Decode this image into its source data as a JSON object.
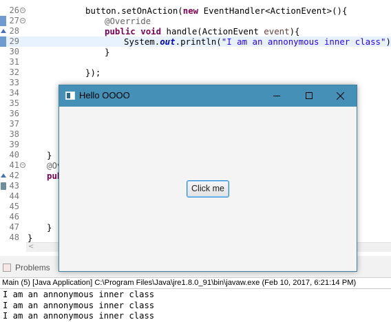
{
  "editor": {
    "lines": [
      {
        "num": "26",
        "fold": "⊖"
      },
      {
        "num": "27",
        "fold": "⊖"
      },
      {
        "num": "28",
        "fold": ""
      },
      {
        "num": "29",
        "fold": ""
      },
      {
        "num": "30",
        "fold": ""
      },
      {
        "num": "31",
        "fold": ""
      },
      {
        "num": "32",
        "fold": ""
      },
      {
        "num": "33",
        "fold": ""
      },
      {
        "num": "34",
        "fold": ""
      },
      {
        "num": "35",
        "fold": ""
      },
      {
        "num": "36",
        "fold": ""
      },
      {
        "num": "37",
        "fold": ""
      },
      {
        "num": "38",
        "fold": ""
      },
      {
        "num": "39",
        "fold": ""
      },
      {
        "num": "40",
        "fold": ""
      },
      {
        "num": "41",
        "fold": "⊖"
      },
      {
        "num": "42",
        "fold": ""
      },
      {
        "num": "43",
        "fold": ""
      },
      {
        "num": "44",
        "fold": ""
      },
      {
        "num": "45",
        "fold": ""
      },
      {
        "num": "46",
        "fold": ""
      },
      {
        "num": "47",
        "fold": ""
      },
      {
        "num": "48",
        "fold": ""
      }
    ],
    "code": {
      "l26_a": "button.setOnAction(",
      "l26_kw": "new",
      "l26_b": " EventHandler<ActionEvent>(){",
      "l27": "@Override",
      "l28_kw1": "public",
      "l28_kw2": "void",
      "l28_a": " handle(ActionEvent ",
      "l28_param": "event",
      "l28_b": "){",
      "l29_a": "System.",
      "l29_fld": "out",
      "l29_b": ".println(",
      "l29_str": "\"I am an annonymous inner class\"",
      "l29_c": ");",
      "l30": "}",
      "l32": "});",
      "l40": "}",
      "l41": "@Ov",
      "l42": "pub",
      "l47": "}",
      "l48": "}"
    },
    "scroll_arrow": "<"
  },
  "panel": {
    "problems_tab": "Problems",
    "console_header": "Main (5) [Java Application] C:\\Program Files\\Java\\jre1.8.0_91\\bin\\javaw.exe (Feb 10, 2017, 6:21:14 PM)",
    "console_lines": [
      "I am an annonymous inner class",
      "I am an annonymous inner class",
      "I am an annonymous inner class"
    ]
  },
  "window": {
    "title": "Hello OOOO",
    "button_label": "Click me",
    "titlebar_color": "#4590b6",
    "button_border_color": "#2c8bd8"
  }
}
